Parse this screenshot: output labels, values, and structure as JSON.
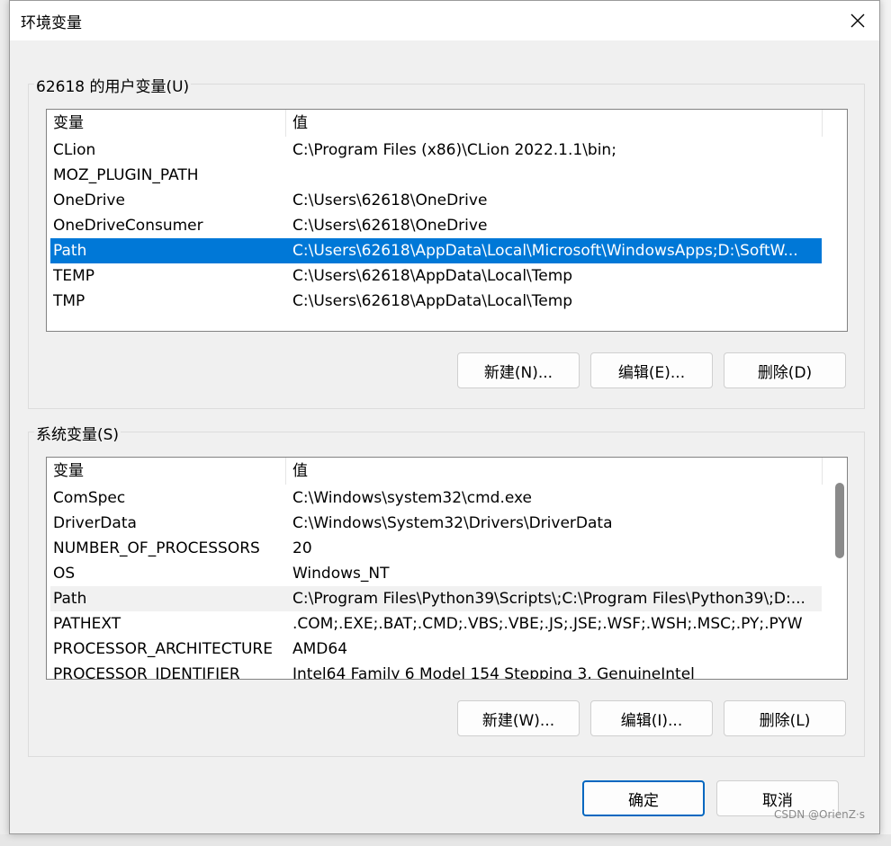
{
  "window": {
    "title": "环境变量",
    "close_icon": "close-icon"
  },
  "user_vars": {
    "group_label": "62618 的用户变量(U)",
    "columns": [
      "变量",
      "值"
    ],
    "rows": [
      {
        "name": "CLion",
        "value": "C:\\Program Files (x86)\\CLion 2022.1.1\\bin;"
      },
      {
        "name": "MOZ_PLUGIN_PATH",
        "value": ""
      },
      {
        "name": "OneDrive",
        "value": "C:\\Users\\62618\\OneDrive"
      },
      {
        "name": "OneDriveConsumer",
        "value": "C:\\Users\\62618\\OneDrive"
      },
      {
        "name": "Path",
        "value": "C:\\Users\\62618\\AppData\\Local\\Microsoft\\WindowsApps;D:\\SoftW..."
      },
      {
        "name": "TEMP",
        "value": "C:\\Users\\62618\\AppData\\Local\\Temp"
      },
      {
        "name": "TMP",
        "value": "C:\\Users\\62618\\AppData\\Local\\Temp"
      }
    ],
    "selected_row": "Path",
    "buttons": {
      "new": "新建(N)...",
      "edit": "编辑(E)...",
      "delete": "删除(D)"
    }
  },
  "system_vars": {
    "group_label": "系统变量(S)",
    "columns": [
      "变量",
      "值"
    ],
    "rows": [
      {
        "name": "ComSpec",
        "value": "C:\\Windows\\system32\\cmd.exe"
      },
      {
        "name": "DriverData",
        "value": "C:\\Windows\\System32\\Drivers\\DriverData"
      },
      {
        "name": "NUMBER_OF_PROCESSORS",
        "value": "20"
      },
      {
        "name": "OS",
        "value": "Windows_NT"
      },
      {
        "name": "Path",
        "value": "C:\\Program Files\\Python39\\Scripts\\;C:\\Program Files\\Python39\\;D:..."
      },
      {
        "name": "PATHEXT",
        "value": ".COM;.EXE;.BAT;.CMD;.VBS;.VBE;.JS;.JSE;.WSF;.WSH;.MSC;.PY;.PYW"
      },
      {
        "name": "PROCESSOR_ARCHITECTURE",
        "value": "AMD64"
      },
      {
        "name": "PROCESSOR_IDENTIFIER",
        "value": "Intel64 Family 6 Model 154 Stepping 3, GenuineIntel"
      }
    ],
    "hovered_row": "Path",
    "buttons": {
      "new": "新建(W)...",
      "edit": "编辑(I)...",
      "delete": "删除(L)"
    }
  },
  "footer": {
    "ok": "确定",
    "cancel": "取消"
  },
  "watermark": "CSDN @OrienZ·s",
  "colors": {
    "selection": "#0078d7",
    "primary_border": "#0067c0",
    "hover_row": "#f1f1f1"
  }
}
